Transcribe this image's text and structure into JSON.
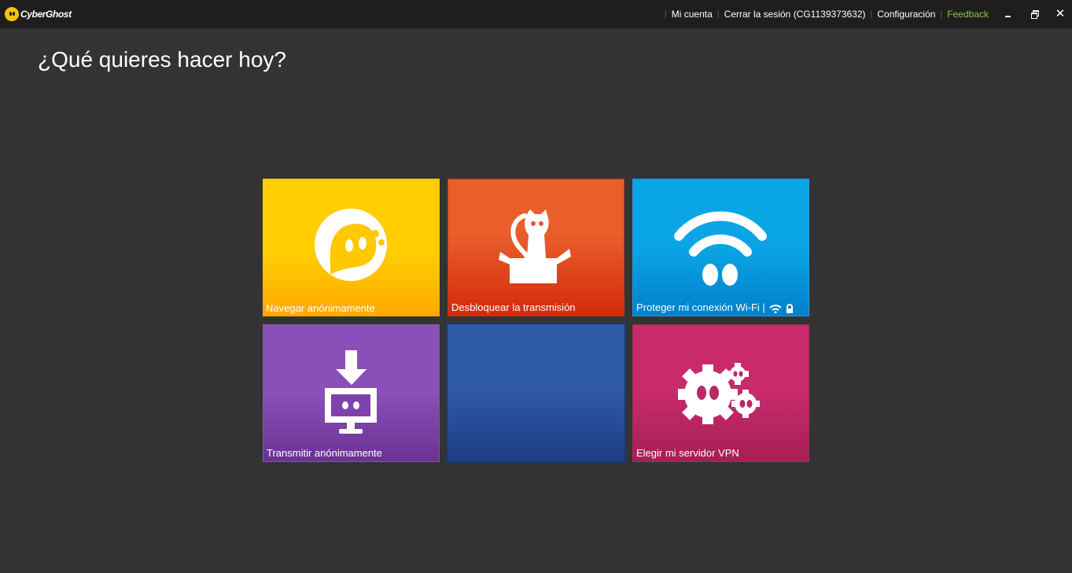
{
  "app": {
    "brand": "CyberGhost"
  },
  "topnav": {
    "account": "Mi cuenta",
    "logout": "Cerrar la sesión (CG1139373632)",
    "settings": "Configuración",
    "feedback": "Feedback"
  },
  "window_controls": {
    "close": "✕"
  },
  "main": {
    "heading": "¿Qué quieres hacer hoy?"
  },
  "tiles": [
    {
      "label": "Navegar anónimamente",
      "icon": "ghost-icon",
      "color": "#ffc300"
    },
    {
      "label": "Desbloquear la transmisión",
      "icon": "cat-box-icon",
      "color": "#e35a2a"
    },
    {
      "label": "Proteger mi conexión Wi-Fi |",
      "icon": "wifi-ghost-icon",
      "color": "#0996db"
    },
    {
      "label": "Transmitir anónimamente",
      "icon": "download-monitor-icon",
      "color": "#7d43ab"
    },
    {
      "label": "",
      "icon": "",
      "color": "#2a4f99"
    },
    {
      "label": "Elegir mi servidor VPN",
      "icon": "gears-icon",
      "color": "#bc2766"
    }
  ],
  "colors": {
    "background": "#333333",
    "titlebar": "#1e1e1e",
    "feedback": "#8cc63f"
  }
}
